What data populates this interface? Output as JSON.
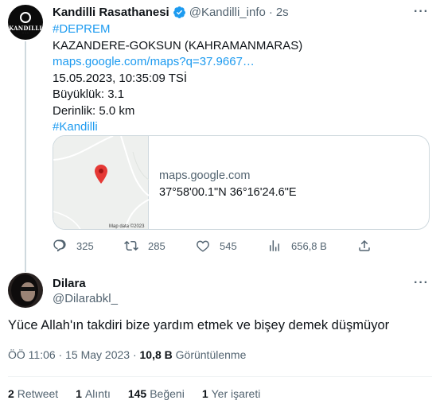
{
  "tweet1": {
    "author_name": "Kandilli Rasathanesi",
    "handle": "@Kandilli_info",
    "separator": "·",
    "time": "2s",
    "more_icon": "more-horizontal-icon",
    "avatar_text": "KANDILLI",
    "lines": {
      "hashtag1": "#DEPREM",
      "location": "KAZANDERE-GOKSUN (KAHRAMANMARAS)",
      "link": "maps.google.com/maps?q=37.9667…",
      "datetime": "15.05.2023, 10:35:09 TSİ",
      "magnitude": "Büyüklük: 3.1",
      "depth": "Derinlik: 5.0 km",
      "hashtag2": "#Kandilli"
    },
    "card": {
      "domain": "maps.google.com",
      "coords": "37°58'00.1\"N 36°16'24.6\"E",
      "map_credit": "Map data ©2023"
    },
    "actions": {
      "replies": "325",
      "retweets": "285",
      "likes": "545",
      "views": "656,8 B"
    }
  },
  "tweet2": {
    "author_name": "Dilara",
    "handle": "@Dilarabkl_",
    "text": "Yüce Allah'ın takdiri bize yardım etmek ve bişey demek düşmüyor",
    "time_date": "ÖÖ 11:06 · 15 May 2023 · ",
    "views_count": "10,8 B",
    "views_label": "Görüntülenme",
    "stats": [
      {
        "count": "2",
        "label": "Retweet"
      },
      {
        "count": "1",
        "label": "Alıntı"
      },
      {
        "count": "145",
        "label": "Beğeni"
      },
      {
        "count": "1",
        "label": "Yer işareti"
      }
    ]
  },
  "colors": {
    "accent": "#1d9bf0",
    "secondary_text": "#536471",
    "border": "#cfd9de",
    "pin": "#e53935"
  }
}
